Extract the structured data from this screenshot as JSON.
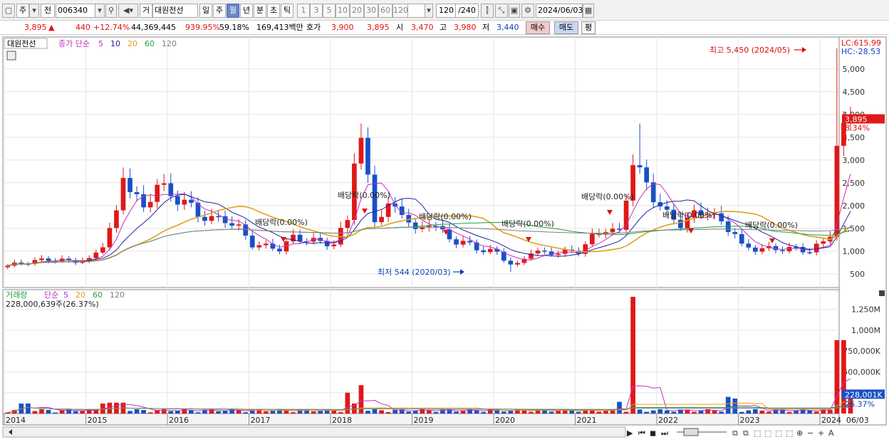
{
  "toolbar": {
    "menu_icon": "window-menu-icon",
    "type_label": "주",
    "type2_label": "전",
    "code_value": "006340",
    "name_prefix": "거",
    "stock_name": "대원전선",
    "periods": [
      "일",
      "주",
      "월",
      "년",
      "분",
      "초",
      "틱"
    ],
    "selected_period": "월",
    "intervals": [
      "1",
      "3",
      "5",
      "10",
      "20",
      "30",
      "60",
      "120"
    ],
    "count_value": "120",
    "count_total": "/240",
    "date_value": "2024/06/03"
  },
  "info": {
    "price": "3,895",
    "arrow": "▲",
    "change": "440",
    "change_pct": "+12.74%",
    "volume": "44,369,445",
    "volume_pct": "939.95%",
    "ratio": "59.18%",
    "amount": "169,413백만",
    "hoga_label": "호가",
    "hoga_ask": "3,900",
    "hoga_bid": "3,895",
    "open_label": "시",
    "open_value": "3,470",
    "high_label": "고",
    "high_value": "3,980",
    "low_label": "저",
    "low_value": "3,440",
    "buy_label": "매수",
    "sell_label": "매도",
    "eval_label": "평"
  },
  "price_pane": {
    "stock_label": "대원전선",
    "legend_prefix": "종가 단순",
    "ma_labels": [
      "5",
      "10",
      "20",
      "60",
      "120"
    ],
    "ma_colors": [
      "#c030c0",
      "#2020a0",
      "#e0a020",
      "#20a040",
      "#808080"
    ],
    "lc_label": "LC:615.99",
    "hc_label": "HC:-28.53",
    "current_tag": "3,895",
    "current_pct": "8.34%",
    "high_note": "최고 5,450 (2024/05)",
    "low_note": "최저 544 (2020/03)",
    "dividend_label": "배당락(0.00%)"
  },
  "volume_pane": {
    "title": "거래량",
    "legend_prefix": "단순",
    "ma_labels": [
      "5",
      "20",
      "60",
      "120"
    ],
    "info": "228,000,639주(26.37%)",
    "current_tag": "228,001K",
    "current_pct": "26.37%"
  },
  "bottom": {
    "end_date": "06/03"
  },
  "chart_data": {
    "type": "candlestick",
    "x_labels": [
      "2014",
      "2015",
      "2016",
      "2017",
      "2018",
      "2019",
      "2020",
      "2021",
      "2022",
      "2023",
      "2024"
    ],
    "price_ticks": [
      500,
      1000,
      1500,
      2000,
      2500,
      3000,
      3500,
      4000,
      4500,
      5000
    ],
    "price_range": [
      200,
      5700
    ],
    "volume_ticks": [
      "250,000K",
      "500,000K",
      "750,000K",
      "1,000M",
      "1,250M"
    ],
    "volume_range_k": [
      0,
      1400000
    ],
    "colors": {
      "up": "#e01818",
      "down": "#1850c8",
      "ma5": "#c030c0",
      "ma10": "#2020a0",
      "ma20": "#e0a020",
      "ma60": "#20a040",
      "ma120": "#808080"
    }
  }
}
